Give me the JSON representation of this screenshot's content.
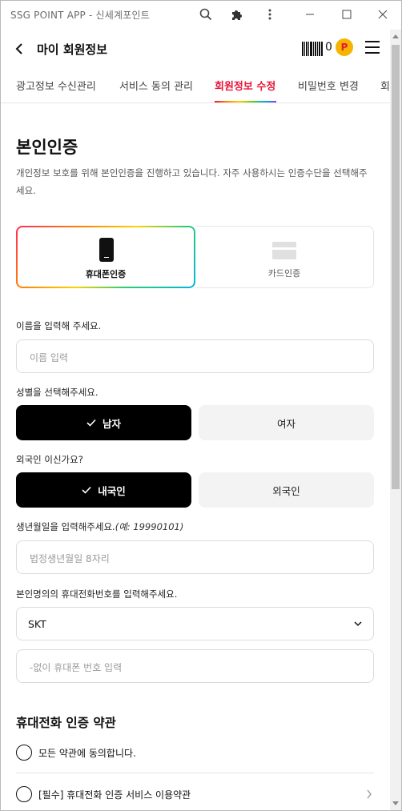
{
  "window": {
    "title": "SSG POINT APP - 신세계포인트"
  },
  "header": {
    "title": "마이 회원정보",
    "point_value": "0",
    "point_coin_letter": "P"
  },
  "tabs": [
    {
      "label": "광고정보 수신관리"
    },
    {
      "label": "서비스 동의 관리"
    },
    {
      "label": "회원정보 수정",
      "active": true
    },
    {
      "label": "비밀번호 변경"
    },
    {
      "label": "회"
    }
  ],
  "auth": {
    "heading": "본인인증",
    "description": "개인정보 보호를 위해 본인인증을 진행하고 있습니다. 자주 사용하시는 인증수단을 선택해주세요.",
    "methods": [
      {
        "label": "휴대폰인증",
        "selected": true
      },
      {
        "label": "카드인증",
        "selected": false
      }
    ]
  },
  "form": {
    "name_label": "이름을 입력해 주세요.",
    "name_placeholder": "이름 입력",
    "gender_label": "성별을 선택해주세요.",
    "gender_options": [
      {
        "label": "남자",
        "selected": true
      },
      {
        "label": "여자",
        "selected": false
      }
    ],
    "foreigner_label": "외국인 이신가요?",
    "foreigner_options": [
      {
        "label": "내국인",
        "selected": true
      },
      {
        "label": "외국인",
        "selected": false
      }
    ],
    "birth_label": "생년월일을 입력해주세요.",
    "birth_example": "(예: 19990101)",
    "birth_placeholder": "법정생년월일 8자리",
    "phone_label": "본인명의의 휴대전화번호를 입력해주세요.",
    "carrier_value": "SKT",
    "phone_placeholder": "-없이 휴대폰 번호 입력"
  },
  "terms": {
    "heading": "휴대전화 인증 약관",
    "agree_all": "모든 약관에 동의합니다.",
    "items": [
      {
        "label": "[필수] 휴대전화 인증 서비스 이용약관"
      }
    ]
  },
  "colors": {
    "accent": "#e8163a",
    "selected_bg": "#000000",
    "unselected_bg": "#f3f3f3",
    "point_coin": "#f5b400"
  },
  "icons": [
    "search-icon",
    "extension-icon",
    "more-vert-icon",
    "minimize-icon",
    "maximize-icon",
    "close-icon",
    "back-arrow-icon",
    "barcode-icon",
    "point-coin-icon",
    "hamburger-menu-icon",
    "phone-icon",
    "card-icon",
    "check-icon",
    "chevron-down-icon",
    "chevron-right-icon"
  ]
}
